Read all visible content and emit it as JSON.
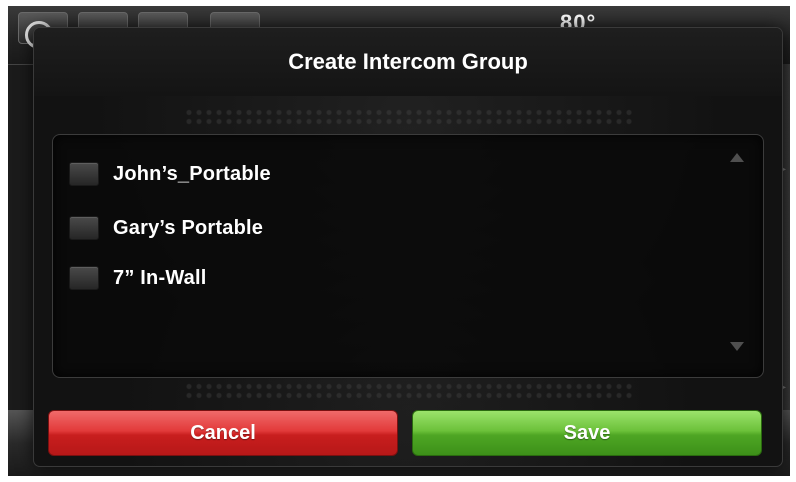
{
  "background": {
    "temperature": "80°"
  },
  "dialog": {
    "title": "Create Intercom Group",
    "items": [
      {
        "label": "John’s_Portable",
        "checked": false
      },
      {
        "label": "Gary’s Portable",
        "checked": false
      },
      {
        "label": "7” In-Wall",
        "checked": false
      }
    ],
    "cancel_label": "Cancel",
    "save_label": "Save"
  },
  "colors": {
    "cancel": "#e23a3a",
    "save": "#6cc13a",
    "dialog_bg": "#121212"
  }
}
